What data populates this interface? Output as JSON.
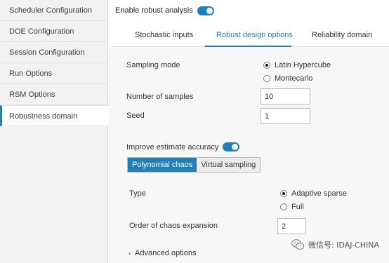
{
  "sidebar": {
    "items": [
      {
        "label": "Scheduler Configuration"
      },
      {
        "label": "DOE Configuration"
      },
      {
        "label": "Session Configuration"
      },
      {
        "label": "Run Options"
      },
      {
        "label": "RSM Options"
      },
      {
        "label": "Robustness domain",
        "active": true
      }
    ]
  },
  "header": {
    "enable_label": "Enable robust analysis",
    "enable_on": true
  },
  "tabs": {
    "items": [
      {
        "label": "Stochastic inputs"
      },
      {
        "label": "Robust design options",
        "active": true
      },
      {
        "label": "Reliability domain"
      }
    ]
  },
  "sampling": {
    "label": "Sampling mode",
    "options": [
      {
        "label": "Latin Hypercube",
        "selected": true
      },
      {
        "label": "Montecarlo",
        "selected": false
      }
    ]
  },
  "samples": {
    "label": "Number of samples",
    "value": "10"
  },
  "seed": {
    "label": "Seed",
    "value": "1"
  },
  "improve": {
    "label": "Improve estimate accuracy",
    "on": true,
    "segments": [
      {
        "label": "Polynomial chaos",
        "selected": true
      },
      {
        "label": "Virtual sampling",
        "selected": false
      }
    ]
  },
  "type": {
    "label": "Type",
    "options": [
      {
        "label": "Adaptive sparse",
        "selected": true
      },
      {
        "label": "Full",
        "selected": false
      }
    ]
  },
  "order": {
    "label": "Order of chaos expansion",
    "value": "2"
  },
  "advanced": {
    "label": "Advanced options",
    "chevron": "›"
  },
  "watermark": {
    "text": "微信号: IDAJ-CHINA",
    "icon": "wechat-icon"
  },
  "colors": {
    "accent": "#1f7fb8",
    "panel_bg": "#f7f7f7",
    "sidebar_bg": "#f2f2f2"
  }
}
